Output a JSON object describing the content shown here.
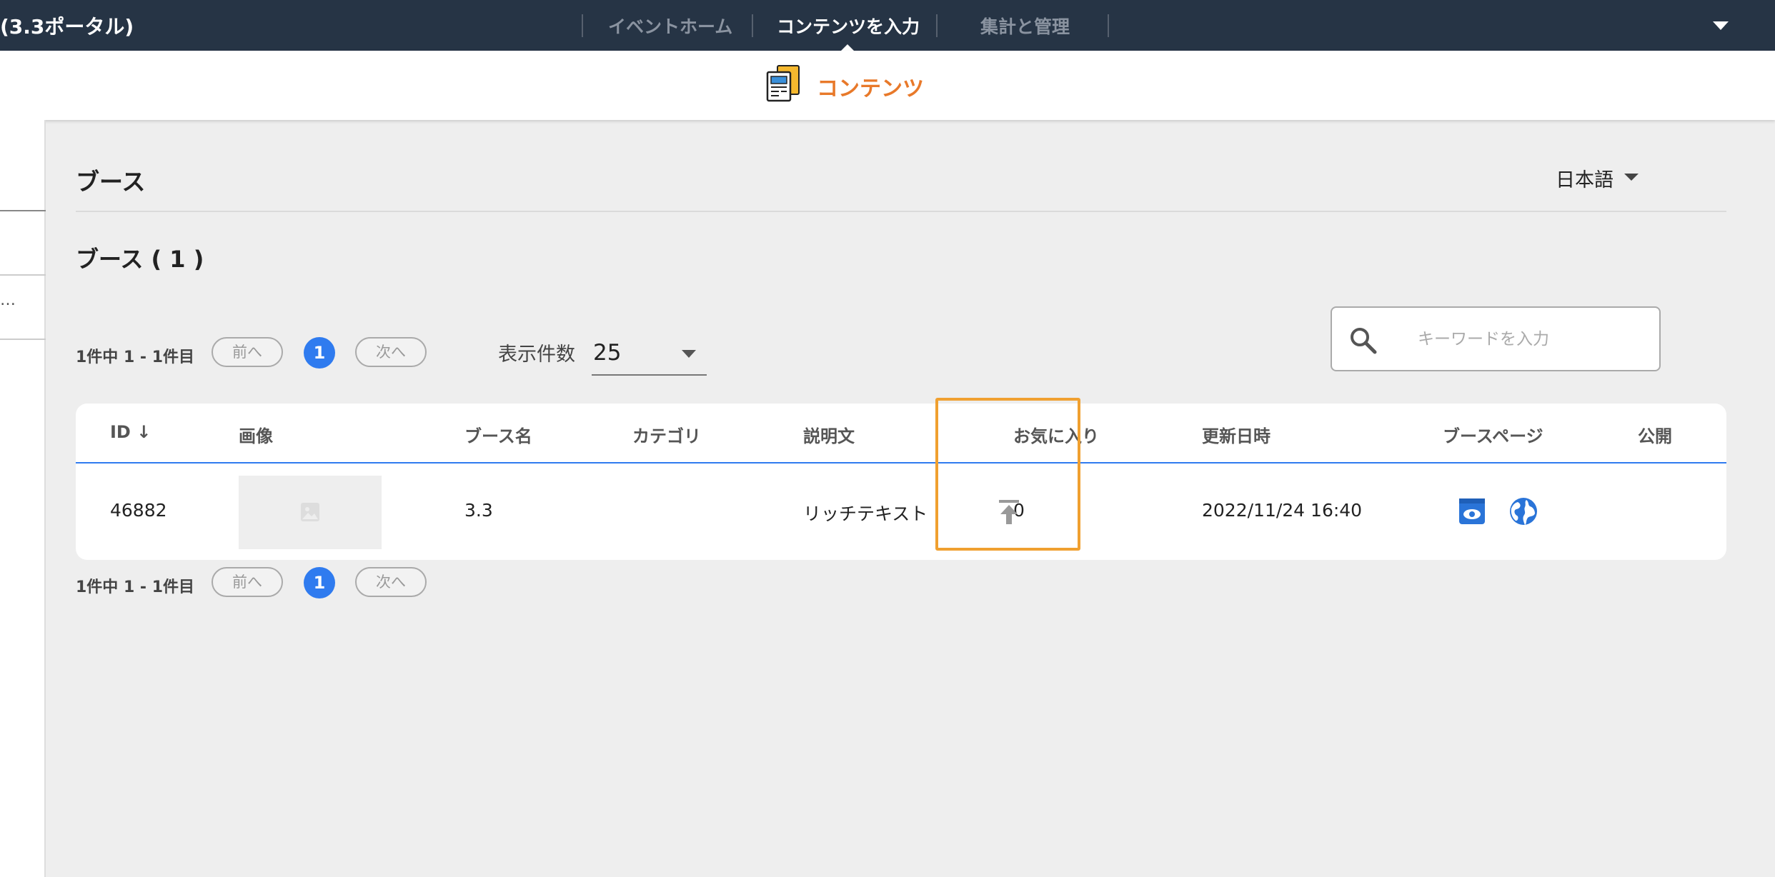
{
  "topbar": {
    "app_title": "(3.3ポータル)",
    "nav": [
      "イベントホーム",
      "コンテンツを入力",
      "集計と管理"
    ],
    "active_nav": "コンテンツを入力"
  },
  "subheader": {
    "label": "コンテンツ",
    "icon": "content-document-icon",
    "accent": "#e8792a"
  },
  "page": {
    "title": "ブース",
    "language": "日本語",
    "section_title": "ブース ( 1 )"
  },
  "pagination": {
    "summary": "1件中 1 - 1件目",
    "prev": "前へ",
    "next": "次へ",
    "current_page": "1"
  },
  "per_page": {
    "label": "表示件数",
    "value": "25"
  },
  "search": {
    "placeholder": "キーワードを入力",
    "value": ""
  },
  "table": {
    "columns": [
      "ID ↓",
      "画像",
      "ブース名",
      "カテゴリ",
      "説明文",
      "お気に入り",
      "更新日時",
      "ブースページ",
      "公開"
    ],
    "rows": [
      {
        "id": "46882",
        "image": "",
        "name": "3.3",
        "category": "",
        "description": "リッチテキスト",
        "favorites": "0",
        "updated": "2022/11/24 16:40",
        "actions": [
          "preview-eye-icon",
          "globe-icon"
        ],
        "publish": "upload-publish-icon"
      }
    ]
  },
  "colors": {
    "header_bg": "#263445",
    "primary": "#2f7bef",
    "highlight": "#f0a030"
  }
}
